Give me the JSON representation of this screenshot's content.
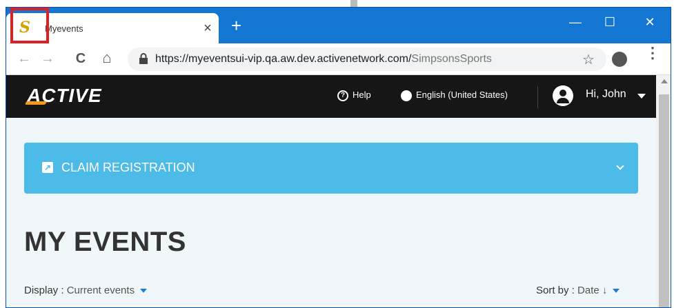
{
  "browser": {
    "tab_title": "Myevents",
    "favicon": "S",
    "close_glyph": "×",
    "new_tab_glyph": "+",
    "window_controls": {
      "minimize": "—",
      "maximize": "☐",
      "close": "✕"
    },
    "nav": {
      "back": "←",
      "forward": "→",
      "reload": "C",
      "home": "⌂"
    },
    "url_host": "https://myeventsui-vip.qa.aw.dev.activenetwork.com/",
    "url_path": "SimpsonsSports",
    "star_glyph": "☆",
    "menu_glyph": "⋮"
  },
  "site_header": {
    "logo": "ACTIVE",
    "help_label": "Help",
    "help_glyph": "?",
    "language_label": "English (United States)",
    "greeting": "Hi, John"
  },
  "claim": {
    "label": "CLAIM REGISTRATION",
    "icon_glyph": "↗"
  },
  "main": {
    "title": "MY EVENTS",
    "display_label": "Display : ",
    "display_value": "Current events",
    "sort_label": "Sort by : ",
    "sort_value": "Date ↓"
  },
  "colors": {
    "titlebar": "#1376d2",
    "claim_bar": "#4dbbe8",
    "header": "#161616",
    "highlight": "#e02020",
    "accent": "#1a7dd4"
  }
}
